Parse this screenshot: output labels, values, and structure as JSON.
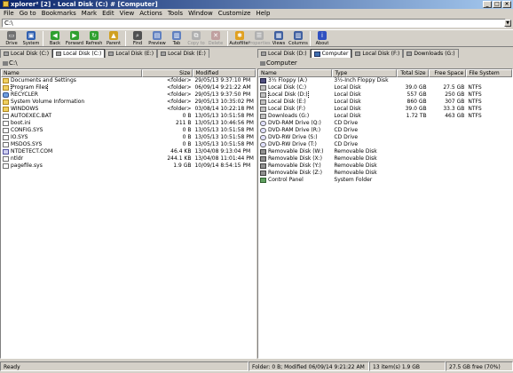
{
  "window": {
    "title": "xplorer² [2] - Local Disk (C:) # [Computer]",
    "buttons": [
      "_",
      "□",
      "×"
    ]
  },
  "menu": [
    "File",
    "Go to",
    "Bookmarks",
    "Mark",
    "Edit",
    "View",
    "Actions",
    "Tools",
    "Window",
    "Customize",
    "Help"
  ],
  "address": {
    "value": "C:\\"
  },
  "toolbar": [
    {
      "label": "Drive",
      "icon": "drive-icon",
      "color": "#707070",
      "glyph": "▭",
      "disabled": false
    },
    {
      "label": "System",
      "icon": "system-icon",
      "color": "#3060b0",
      "glyph": "▣",
      "disabled": false
    },
    {
      "sep": true
    },
    {
      "label": "Back",
      "icon": "back-arrow-icon",
      "color": "#30a030",
      "glyph": "◀",
      "disabled": false
    },
    {
      "label": "Forward",
      "icon": "forward-arrow-icon",
      "color": "#30a030",
      "glyph": "▶",
      "disabled": false
    },
    {
      "label": "Refresh",
      "icon": "refresh-icon",
      "color": "#30a030",
      "glyph": "↻",
      "disabled": false
    },
    {
      "label": "Parent",
      "icon": "parent-folder-icon",
      "color": "#d0a020",
      "glyph": "▲",
      "disabled": false
    },
    {
      "sep": true
    },
    {
      "label": "Find",
      "icon": "find-icon",
      "color": "#505050",
      "glyph": "⌕",
      "disabled": false
    },
    {
      "label": "Preview",
      "icon": "preview-icon",
      "color": "#6080c0",
      "glyph": "▤",
      "disabled": false
    },
    {
      "label": "Tab",
      "icon": "tab-icon",
      "color": "#6080c0",
      "glyph": "▥",
      "disabled": false
    },
    {
      "label": "Copy to",
      "icon": "copy-to-icon",
      "color": "#b0b0b0",
      "glyph": "⧉",
      "disabled": true
    },
    {
      "label": "Delete",
      "icon": "delete-icon",
      "color": "#c0a0a0",
      "glyph": "✕",
      "disabled": true
    },
    {
      "sep": true
    },
    {
      "label": "Autofilter",
      "icon": "autofilter-icon",
      "color": "#e0a020",
      "glyph": "✱",
      "disabled": false
    },
    {
      "label": "Properties",
      "icon": "properties-icon",
      "color": "#b0b0b0",
      "glyph": "☰",
      "disabled": true
    },
    {
      "label": "Views",
      "icon": "views-icon",
      "color": "#4060a0",
      "glyph": "▦",
      "disabled": false
    },
    {
      "label": "Columns",
      "icon": "columns-icon",
      "color": "#4060a0",
      "glyph": "▥",
      "disabled": false
    },
    {
      "sep": true
    },
    {
      "label": "About",
      "icon": "about-icon",
      "color": "#3050c0",
      "glyph": "i",
      "disabled": false
    }
  ],
  "left_tabs": [
    {
      "label": "Local Disk (C:)",
      "active": false
    },
    {
      "label": "Local Disk (C:)",
      "active": true
    },
    {
      "label": "Local Disk (E:)",
      "active": false
    },
    {
      "label": "Local Disk (E:)",
      "active": false
    }
  ],
  "right_tabs": [
    {
      "label": "Local Disk (D:)",
      "active": false,
      "pc": false
    },
    {
      "label": "Computer",
      "active": true,
      "pc": true
    },
    {
      "label": "Local Disk (F:)",
      "active": false,
      "pc": false
    },
    {
      "label": "Downloads (G:)",
      "active": false,
      "pc": false
    }
  ],
  "left_path": "C:\\",
  "right_path": "Computer",
  "left_columns": [
    "Name",
    "Size",
    "Modified"
  ],
  "left_rows": [
    {
      "icon": "folder",
      "name": "Documents and Settings",
      "size": "<folder>",
      "modified": "29/05/13 9:37:10 PM",
      "selected": false
    },
    {
      "icon": "folder",
      "name": "Program Files",
      "size": "<folder>",
      "modified": "06/09/14 9:21:22 AM",
      "selected": true
    },
    {
      "icon": "recycle",
      "name": "RECYCLER",
      "size": "<folder>",
      "modified": "29/05/13 9:37:50 PM",
      "selected": false
    },
    {
      "icon": "folder",
      "name": "System Volume Information",
      "size": "<folder>",
      "modified": "29/05/13 10:35:02 PM",
      "selected": false
    },
    {
      "icon": "folder",
      "name": "WINDOWS",
      "size": "<folder>",
      "modified": "03/08/14 10:22:18 PM",
      "selected": false
    },
    {
      "icon": "file",
      "name": "AUTOEXEC.BAT",
      "size": "0 B",
      "modified": "13/05/13 10:51:58 PM",
      "selected": false
    },
    {
      "icon": "file",
      "name": "boot.ini",
      "size": "211 B",
      "modified": "13/05/13 10:46:56 PM",
      "selected": false
    },
    {
      "icon": "file",
      "name": "CONFIG.SYS",
      "size": "0 B",
      "modified": "13/05/13 10:51:58 PM",
      "selected": false
    },
    {
      "icon": "file",
      "name": "IO.SYS",
      "size": "0 B",
      "modified": "13/05/13 10:51:58 PM",
      "selected": false
    },
    {
      "icon": "file",
      "name": "MSDOS.SYS",
      "size": "0 B",
      "modified": "13/05/13 10:51:58 PM",
      "selected": false
    },
    {
      "icon": "exe",
      "name": "NTDETECT.COM",
      "size": "46.4 KB",
      "modified": "13/04/08 9:13:04 PM",
      "selected": false
    },
    {
      "icon": "file",
      "name": "ntldr",
      "size": "244.1 KB",
      "modified": "13/04/08 11:01:44 PM",
      "selected": false
    },
    {
      "icon": "file",
      "name": "pagefile.sys",
      "size": "1.9 GB",
      "modified": "10/09/14 8:54:15 PM",
      "selected": false
    }
  ],
  "right_columns": [
    "Name",
    "Type",
    "Total Size",
    "Free Space",
    "File System"
  ],
  "right_rows": [
    {
      "icon": "floppy",
      "name": "3½ Floppy (A:)",
      "type": "3½-Inch Floppy Disk",
      "total": "",
      "free": "",
      "fs": "",
      "selected": false
    },
    {
      "icon": "drive",
      "name": "Local Disk (C:)",
      "type": "Local Disk",
      "total": "39.0 GB",
      "free": "27.5 GB",
      "fs": "NTFS",
      "selected": false
    },
    {
      "icon": "drive",
      "name": "Local Disk (D:)",
      "type": "Local Disk",
      "total": "557 GB",
      "free": "250 GB",
      "fs": "NTFS",
      "selected": true
    },
    {
      "icon": "drive",
      "name": "Local Disk (E:)",
      "type": "Local Disk",
      "total": "860 GB",
      "free": "307 GB",
      "fs": "NTFS",
      "selected": false
    },
    {
      "icon": "drive",
      "name": "Local Disk (F:)",
      "type": "Local Disk",
      "total": "39.0 GB",
      "free": "33.3 GB",
      "fs": "NTFS",
      "selected": false
    },
    {
      "icon": "drive",
      "name": "Downloads (G:)",
      "type": "Local Disk",
      "total": "1.72 TB",
      "free": "463 GB",
      "fs": "NTFS",
      "selected": false
    },
    {
      "icon": "cdrom",
      "name": "DVD-RAM Drive (Q:)",
      "type": "CD Drive",
      "total": "",
      "free": "",
      "fs": "",
      "selected": false
    },
    {
      "icon": "cdrom",
      "name": "DVD-RAM Drive (R:)",
      "type": "CD Drive",
      "total": "",
      "free": "",
      "fs": "",
      "selected": false
    },
    {
      "icon": "cdrom",
      "name": "DVD-RW Drive (S:)",
      "type": "CD Drive",
      "total": "",
      "free": "",
      "fs": "",
      "selected": false
    },
    {
      "icon": "cdrom",
      "name": "DVD-RW Drive (T:)",
      "type": "CD Drive",
      "total": "",
      "free": "",
      "fs": "",
      "selected": false
    },
    {
      "icon": "removable",
      "name": "Removable Disk (W:)",
      "type": "Removable Disk",
      "total": "",
      "free": "",
      "fs": "",
      "selected": false
    },
    {
      "icon": "removable",
      "name": "Removable Disk (X:)",
      "type": "Removable Disk",
      "total": "",
      "free": "",
      "fs": "",
      "selected": false
    },
    {
      "icon": "removable",
      "name": "Removable Disk (Y:)",
      "type": "Removable Disk",
      "total": "",
      "free": "",
      "fs": "",
      "selected": false
    },
    {
      "icon": "removable",
      "name": "Removable Disk (Z:)",
      "type": "Removable Disk",
      "total": "",
      "free": "",
      "fs": "",
      "selected": false
    },
    {
      "icon": "control",
      "name": "Control Panel",
      "type": "System Folder",
      "total": "",
      "free": "",
      "fs": "",
      "selected": false
    }
  ],
  "status": {
    "ready": "Ready",
    "folder_info": "Folder: 0 B; Modified 06/09/14 9:21:22 AM",
    "items": "13 item(s) 1.9 GB",
    "free": "27.5 GB free (70%)"
  }
}
